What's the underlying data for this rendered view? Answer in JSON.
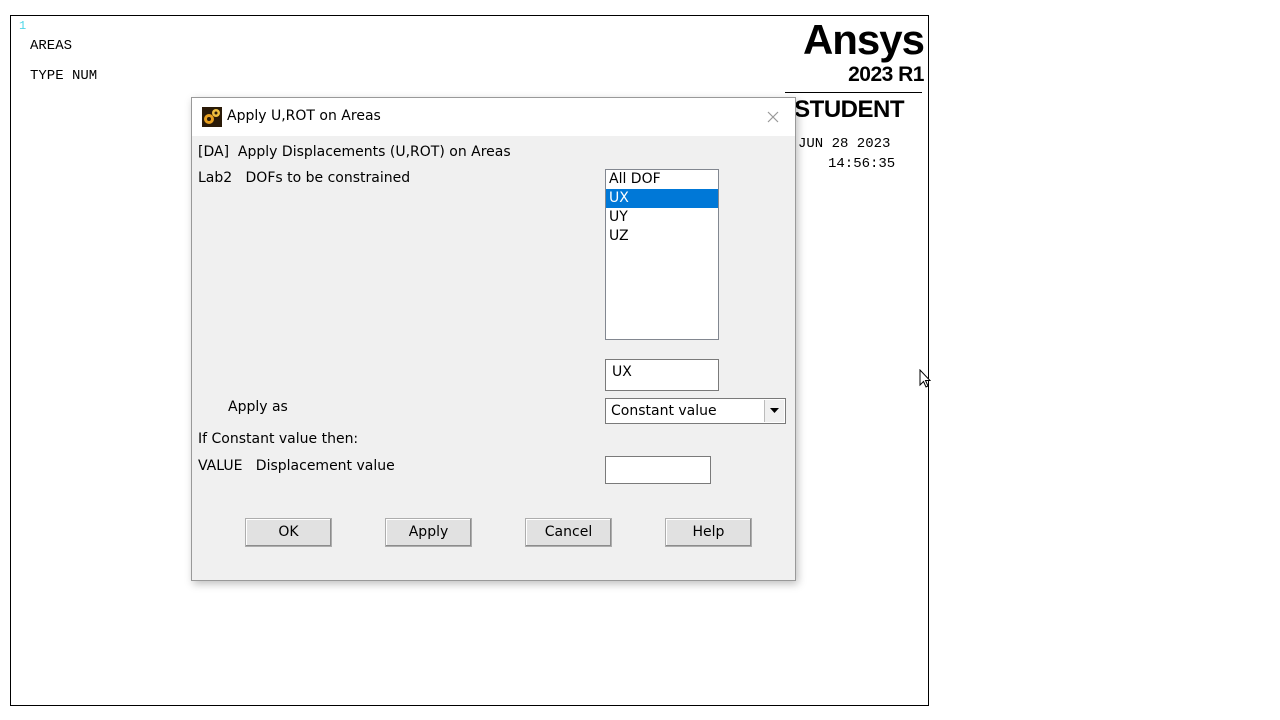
{
  "graphics": {
    "window_number": "1",
    "line1": "AREAS",
    "line2": "TYPE NUM",
    "logo": {
      "name": "Ansys",
      "version": "2023 R1",
      "edition": "STUDENT"
    },
    "date": "JUN 28 2023",
    "time": "14:56:35"
  },
  "dialog": {
    "title": "Apply U,ROT on Areas",
    "header": "[DA]  Apply Displacements (U,ROT) on Areas",
    "lab2_label": "Lab2   DOFs to be constrained",
    "dof_options": [
      "All DOF",
      "UX",
      "UY",
      "UZ"
    ],
    "selected_dof": "UX",
    "dof_selection_text": "UX",
    "apply_as_label": "Apply as",
    "apply_as_value": "Constant value",
    "if_constant_label": "If Constant value then:",
    "value_label": "VALUE   Displacement value",
    "value_input": "",
    "buttons": {
      "ok": "OK",
      "apply": "Apply",
      "cancel": "Cancel",
      "help": "Help"
    }
  },
  "colors": {
    "selection": "#0078d7",
    "window_number": "#4fd6e8"
  }
}
